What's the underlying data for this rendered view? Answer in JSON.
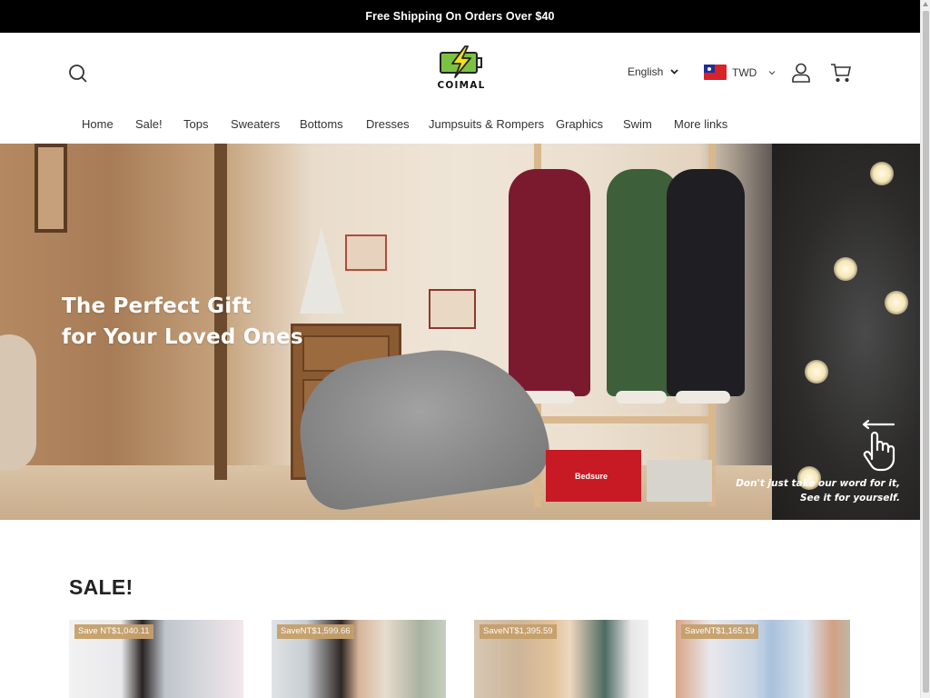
{
  "announcement": {
    "text": "Free Shipping On Orders Over $40"
  },
  "header": {
    "logo_text": "COIMAL",
    "language": {
      "selected": "English"
    },
    "currency": {
      "selected": "TWD",
      "flag": "taiwan-flag"
    },
    "icons": [
      "search-icon",
      "user-icon",
      "cart-icon"
    ],
    "brand_colors": {
      "logo_green": "#7cc242",
      "logo_bolt": "#f2e01a",
      "badge": "#c6a06b"
    }
  },
  "nav": {
    "items": [
      {
        "label": "Home"
      },
      {
        "label": "Sale!"
      },
      {
        "label": "Tops"
      },
      {
        "label": "Sweaters"
      },
      {
        "label": "Bottoms"
      },
      {
        "label": "Dresses"
      },
      {
        "label": "Jumpsuits & Rompers"
      },
      {
        "label": "Graphics"
      },
      {
        "label": "Swim"
      },
      {
        "label": "More links"
      }
    ]
  },
  "hero": {
    "title_line1": "The Perfect Gift",
    "title_line2": "for Your Loved Ones",
    "tagline_line1": "Don't just take our word for it,",
    "tagline_line2": "See it for yourself.",
    "box_brand": "Bedsure"
  },
  "sale": {
    "title": "SALE!",
    "products": [
      {
        "badge": "Save NT$1,040.11"
      },
      {
        "badge": "SaveNT$1,599.66"
      },
      {
        "badge": "SaveNT$1,395.59"
      },
      {
        "badge": "SaveNT$1,165.19"
      }
    ]
  }
}
